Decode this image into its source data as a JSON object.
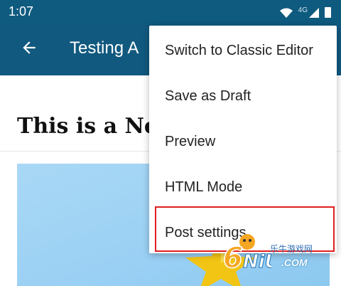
{
  "status_bar": {
    "time": "1:07",
    "network": "4G"
  },
  "app_bar": {
    "title": "Testing A"
  },
  "post": {
    "title": "This is a New"
  },
  "menu": {
    "items": [
      {
        "label": "Switch to Classic Editor"
      },
      {
        "label": "Save as Draft"
      },
      {
        "label": "Preview"
      },
      {
        "label": "HTML Mode"
      },
      {
        "label": "Post settings"
      }
    ]
  },
  "watermark": {
    "digit": "6",
    "chinese": "乐牛游戏网",
    "domain": ".COM"
  },
  "colors": {
    "app_bar": "#11597f",
    "status_bar": "#0f5a7f",
    "highlight": "#e02020"
  }
}
